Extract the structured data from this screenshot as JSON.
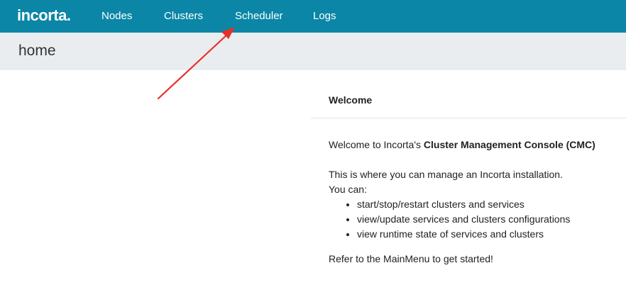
{
  "app": {
    "logo_text": "incorta.",
    "brand_color": "#0b86a6"
  },
  "nav": {
    "items": [
      {
        "label": "Nodes"
      },
      {
        "label": "Clusters"
      },
      {
        "label": "Scheduler"
      },
      {
        "label": "Logs"
      }
    ]
  },
  "page": {
    "title": "home"
  },
  "welcome_panel": {
    "title": "Welcome",
    "intro_prefix": "Welcome to Incorta's ",
    "intro_bold": "Cluster Management Console (CMC)",
    "description": "This is where you can manage an Incorta installation.",
    "you_can": "You can:",
    "features": [
      "start/stop/restart clusters and services",
      "view/update services and clusters configurations",
      "view runtime state of services and clusters"
    ],
    "outro": "Refer to the MainMenu to get started!"
  },
  "annotation": {
    "arrow_color": "#e8302a"
  }
}
